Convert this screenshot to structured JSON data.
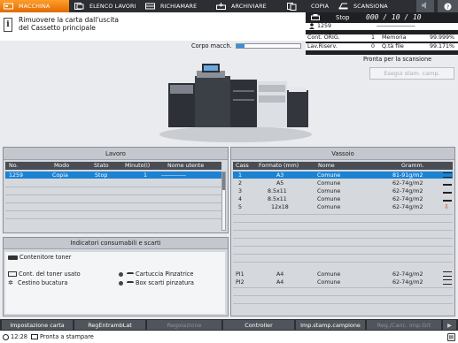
{
  "tabs": [
    {
      "label": "MACCHINA",
      "icon": "machine-icon",
      "active": true
    },
    {
      "label": "ELENCO LAVORI",
      "icon": "job-list-icon",
      "active": false
    },
    {
      "label": "RICHIAMARE",
      "icon": "recall-icon",
      "active": false
    },
    {
      "label": "ARCHIVIARE",
      "icon": "archive-icon",
      "active": false
    },
    {
      "label": "COPIA",
      "icon": "copy-icon",
      "active": false
    },
    {
      "label": "SCANSIONA",
      "icon": "scan-icon",
      "active": false
    }
  ],
  "message": {
    "line1": "Rimuovere la carta dall'uscita",
    "line2": "del Cassetto principale"
  },
  "status": {
    "state": "Stop",
    "counter": "000 / 10 / 10",
    "job_id": "1259",
    "job_dashes": "----------------------",
    "cont_orig_label": "Cont. ORIG.",
    "cont_orig_value": "1",
    "memoria_label": "Memoria",
    "memoria_value": "99.999%",
    "lav_riserv_label": "Lav.Riserv.",
    "lav_riserv_value": "0",
    "qta_file_label": "Q.tà file",
    "qta_file_value": "99.171%"
  },
  "corpo": {
    "label": "Corpo macch.",
    "progress": 0.12
  },
  "pronta_scansione": "Pronta per la scansione",
  "esegui_button": "Esegui stam. camp.",
  "lavoro": {
    "title": "Lavoro",
    "headers": [
      "No.",
      "Modo",
      "Stato",
      "Minuto(i)",
      "Nome utente"
    ],
    "rows": [
      {
        "no": "1259",
        "modo": "Copia",
        "stato": "Stop",
        "minuti": "1",
        "utente": "--------------"
      }
    ]
  },
  "consumabili": {
    "title": "Indicatori consumabili e scarti",
    "items": [
      "Contenitore toner",
      "Cont. del toner usato",
      "Cestino bucatura",
      "Cartuccia Pinzatrice",
      "Box scarti pinzatura"
    ]
  },
  "vassoio": {
    "title": "Vassoio",
    "headers": [
      "Cass",
      "Formato (mm)",
      "Nome",
      "Gramm."
    ],
    "rows": [
      {
        "cass": "1",
        "formato": "A3",
        "nome": "Comune",
        "gramm": "81-91g/m2",
        "selected": true
      },
      {
        "cass": "2",
        "formato": "A5",
        "nome": "Comune",
        "gramm": "62-74g/m2",
        "selected": false
      },
      {
        "cass": "3",
        "formato": "8.5x11",
        "nome": "Comune",
        "gramm": "62-74g/m2",
        "selected": false
      },
      {
        "cass": "4",
        "formato": "8.5x11",
        "nome": "Comune",
        "gramm": "62-74g/m2",
        "selected": false
      },
      {
        "cass": "5",
        "formato": "12x18",
        "nome": "Comune",
        "gramm": "62-74g/m2",
        "selected": false
      }
    ],
    "pi_rows": [
      {
        "cass": "PI1",
        "formato": "A4",
        "nome": "Comune",
        "gramm": "62-74g/m2"
      },
      {
        "cass": "PI2",
        "formato": "A4",
        "nome": "Comune",
        "gramm": "62-74g/m2"
      }
    ]
  },
  "bottom_tabs": [
    {
      "label": "Impostazione carta",
      "disabled": false
    },
    {
      "label": "RegEntrambLat",
      "disabled": false
    },
    {
      "label": "Regolazione",
      "disabled": true
    },
    {
      "label": "Controller",
      "disabled": false
    },
    {
      "label": "Imp.stamp.campione",
      "disabled": false
    },
    {
      "label": "Reg./Canc. Imp.Grt",
      "disabled": true
    }
  ],
  "statusbar": {
    "time": "12:28",
    "text": "Pronta a stampare"
  },
  "colors": {
    "accent": "#e87a10",
    "selected": "#1c82d2"
  }
}
